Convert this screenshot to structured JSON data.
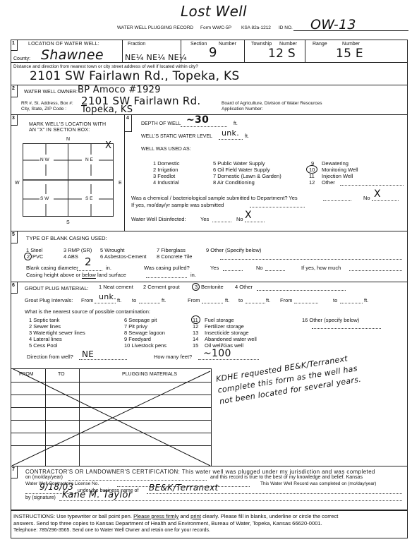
{
  "header": {
    "annotation_title": "Lost Well",
    "form_title": "WATER WELL PLUGGING RECORD",
    "form_number": "Form WWC-5P",
    "statute": "KSA 82a-1212",
    "id_label": "ID NO.",
    "id_value": "OW-13"
  },
  "section1": {
    "number": "1",
    "title": "LOCATION OF WATER WELL:",
    "county_label": "County:",
    "county_value": "Shawnee",
    "fraction_label": "Fraction",
    "fraction_value": "NE¼ NE¼ NE¼",
    "section_label": "Section",
    "section_number_label": "Number",
    "section_value": "9",
    "township_label": "Township",
    "township_number_label": "Number",
    "township_value": "12 S",
    "range_label": "Range",
    "range_number_label": "Number",
    "range_value": "15 E",
    "distance_label": "Distance and direction from nearest town or city street address of well if located within city?",
    "distance_value": "2101 SW Fairlawn Rd., Topeka, KS"
  },
  "section2": {
    "number": "2",
    "owner_label": "WATER WELL OWNER:",
    "owner_value": "BP Amoco #1929",
    "address_label": "RR #, St. Address, Box #:",
    "address_value": "2101 SW Fairlawn Rd.",
    "city_label": "City, State, ZIP Code   :",
    "city_value": "Topeka, KS",
    "board_label": "Board of Agriculture, Division of Water Resources",
    "application_label": "Application Number:"
  },
  "section3": {
    "number": "3",
    "title_line1": "MARK WELL'S LOCATION WITH",
    "title_line2": "AN \"X\" IN SECTION BOX:",
    "compass": {
      "n": "N",
      "s": "S",
      "e": "E",
      "w": "W"
    },
    "quadrants": {
      "nw": "N W",
      "ne": "N E",
      "sw": "S W",
      "se": "S E"
    },
    "mark": "X"
  },
  "section4": {
    "number": "4",
    "depth_label": "DEPTH OF WELL",
    "depth_value": "~30",
    "depth_unit": "ft.",
    "static_label": "WELL'S STATIC WATER LEVEL",
    "static_value": "unk.",
    "static_unit": "ft.",
    "used_as_label": "WELL WAS USED AS:",
    "uses": [
      "1  Domestic",
      "2  Irrigation",
      "3  Feedlot",
      "4  Industrial",
      "5  Public Water Supply",
      "6  Oil Field Water Supply",
      "7  Domestic (Lawn & Garden)",
      "8  Air Conditioning",
      "9",
      "10",
      "11",
      "12"
    ],
    "uses_right_labels": [
      "Dewatering",
      "Monitoring Well",
      "Injection Well",
      "Other"
    ],
    "selected_use": "10 Monitoring Well",
    "sample_label": "Was a chemical / bacteriological sample submitted to Department? Yes",
    "sample_no_label": "No",
    "sample_answer": "X",
    "sample_date_label": "If yes, mo/day/yr  sample was submitted",
    "disinfected_label": "Water Well Disinfected:",
    "disinfected_yes": "Yes",
    "disinfected_no": "No",
    "disinfected_answer": "X"
  },
  "section5": {
    "number": "5",
    "title": "TYPE OF BLANK CASING USED:",
    "options": [
      "1  Steel",
      "2",
      "3  RMP (SR)",
      "4  ABS",
      "5  Wrought",
      "6  Asbestos-Cement",
      "7  Fiberglass",
      "8  Concrete Tile",
      "9  Other (Specify below)"
    ],
    "pvc_label": "PVC",
    "selected": "2 PVC",
    "diameter_label": "Blank casing diameter",
    "diameter_value": "2",
    "diameter_unit": "in.",
    "pulled_label": "Was casing pulled?",
    "pulled_yes": "Yes",
    "pulled_no": "No",
    "how_much_label": "If yes, how much",
    "height_label_pre": "Casing height above or",
    "height_label_below": "below",
    "height_label_post": "land surface",
    "height_unit": "in."
  },
  "section6": {
    "number": "6",
    "material_label": "GROUT PLUG MATERIAL:",
    "materials": [
      "1  Neat cement",
      "2  Cement grout",
      "3",
      "Bentonite",
      "4  Other"
    ],
    "selected_material": "3 Bentonite",
    "intervals_label": "Grout Plug Intervals:",
    "from_label": "From",
    "to_label": "to",
    "ft_label": "ft.",
    "interval1_from": "unk.",
    "contamination_label": "What is the nearest source of possible contamination:",
    "sources": [
      "1 Septic tank",
      "2 Sewer lines",
      "3 Watertight sewer lines",
      "4 Lateral lines",
      "5 Cess Pool",
      "6  Seepage pit",
      "7  Pit privy",
      "8  Sewage lagoon",
      "9  Feedyard",
      "10 Livestock pens",
      "11",
      "12",
      "13",
      "14",
      "15",
      "16  Other (specify below)"
    ],
    "sources_right_labels": [
      "Fuel storage",
      "Fertilizer storage",
      "Insecticide storage",
      "Abandoned water well",
      "Oil well/Gas well"
    ],
    "selected_source": "11 Fuel storage",
    "direction_label": "Direction from well?",
    "direction_value": "NE",
    "feet_label": "How many feet?",
    "feet_value": "~100"
  },
  "plugging_table": {
    "headers": [
      "FROM",
      "TO",
      "PLUGGING MATERIALS"
    ],
    "rows": [
      [
        "",
        "",
        ""
      ],
      [
        "",
        "",
        ""
      ],
      [
        "",
        "",
        ""
      ],
      [
        "",
        "",
        ""
      ],
      [
        "",
        "",
        ""
      ],
      [
        "",
        "",
        ""
      ],
      [
        "",
        "",
        ""
      ]
    ],
    "crossed_out": true
  },
  "annotation_note": {
    "line1": "KDHE requested BE&K/Terranext",
    "line2": "complete this form as the well has",
    "line3": "not been located for several years."
  },
  "section7": {
    "number": "7",
    "line1": "CONTRACTOR'S OR LANDOWNER'S CERTIFICATION: This water well was plugged under my jurisdiction and was completed",
    "line2a": "on (mo/day/year)",
    "line2b": "and this record is true to the best of my knowledge and belief. Kansas",
    "line3a": "Water Well Contractor's License No.",
    "line3b": "This Water Well Record was completed on (mo/day/year)",
    "completed_date": "9/18/03",
    "business_label": "under the business name of",
    "business_value": "BE&K/Terranext",
    "signature_label": "by (signature)",
    "signature_value": "Kane M. Taylor"
  },
  "instructions": {
    "prefix": "INSTRUCTIONS:  Use typewriter or ball point pen.",
    "underline1": "Please press firmly",
    "middle": "and",
    "underline2": "print",
    "rest1": "clearly. Please fill in blanks, underline or circle the correct",
    "line2": "answers. Send top three copies to Kansas Department of Health and Environment, Bureau of Water, Topeka, Kansas 66620-0001.",
    "line3": "Telephone: 785/296-3565. Send one to Water Well Owner and retain one for your records."
  }
}
